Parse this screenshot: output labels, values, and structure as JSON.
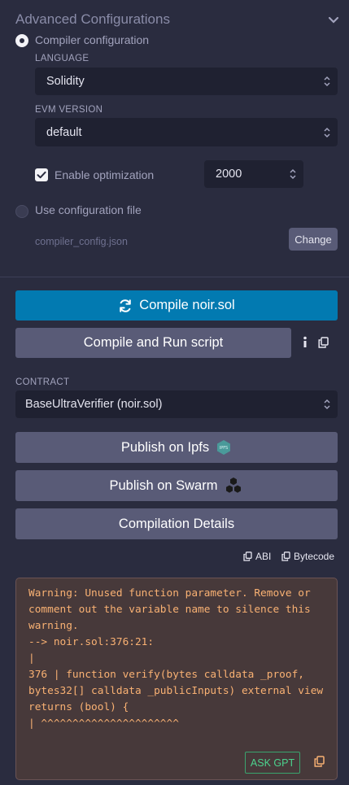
{
  "section_title": "Advanced Configurations",
  "compiler_config_label": "Compiler configuration",
  "language": {
    "label": "LANGUAGE",
    "value": "Solidity"
  },
  "evm_version": {
    "label": "EVM VERSION",
    "value": "default"
  },
  "optimization": {
    "label": "Enable optimization",
    "runs": "2000",
    "enabled": true
  },
  "config_file": {
    "label": "Use configuration file",
    "filename": "compiler_config.json",
    "change_label": "Change"
  },
  "buttons": {
    "compile": "Compile noir.sol",
    "compile_run": "Compile and Run script",
    "publish_ipfs": "Publish on Ipfs",
    "publish_swarm": "Publish on Swarm",
    "details": "Compilation Details"
  },
  "contract": {
    "label": "CONTRACT",
    "value": "BaseUltraVerifier (noir.sol)"
  },
  "copy_links": {
    "abi": "ABI",
    "bytecode": "Bytecode"
  },
  "ipfs_badge": "IPFS",
  "warning": {
    "text": "Warning: Unused function parameter. Remove or\ncomment out the variable name to silence this\nwarning.\n--> noir.sol:376:21:\n|\n376 | function verify(bytes calldata _proof,\nbytes32[] calldata _publicInputs) external view\nreturns (bool) {\n| ^^^^^^^^^^^^^^^^^^^^^^",
    "ask_gpt": "ASK GPT"
  },
  "colors": {
    "background": "#2a2c3f",
    "primary": "#027ab1",
    "secondary": "#595b77",
    "warning_text": "#f9b173",
    "ask_gpt": "#4cd38e"
  }
}
